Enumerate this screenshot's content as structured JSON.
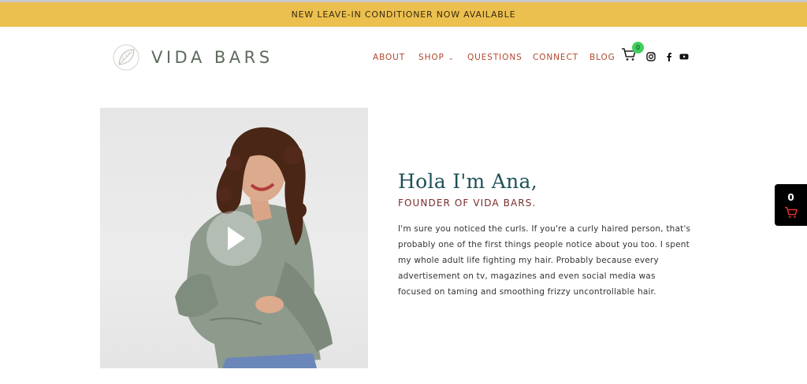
{
  "announcement": "NEW LEAVE-IN CONDITIONER NOW AVAILABLE",
  "brand": {
    "name": "VIDA BARS",
    "icon": "leaf-icon"
  },
  "nav": {
    "items": [
      {
        "label": "ABOUT"
      },
      {
        "label": "SHOP",
        "icon": "chevron-down-icon"
      },
      {
        "label": "QUESTIONS"
      },
      {
        "label": "CONNECT"
      },
      {
        "label": "BLOG"
      }
    ],
    "cart_count": "0",
    "social": [
      "instagram-icon",
      "facebook-icon",
      "youtube-icon"
    ]
  },
  "hero": {
    "heading": "Hola I'm Ana,",
    "subheading": "FOUNDER OF VIDA BARS.",
    "bio": "I'm sure you noticed the curls. If you're a curly haired person, that's probably one of the first things people notice about you too. I spent my whole adult life fighting my hair. Probably because every advertisement on tv, magazines and even social media was focused on taming and smoothing frizzy uncontrollable hair.",
    "video_icon": "play-icon"
  },
  "floating_cart": {
    "count": "0",
    "icon": "cart-icon"
  },
  "colors": {
    "announcement_bg": "#ecc04f",
    "nav_link": "#b0472c",
    "heading": "#1f5258",
    "subheading": "#7a2c2c",
    "cart_badge": "#3fcf5d",
    "cart_red": "#e0322b"
  }
}
